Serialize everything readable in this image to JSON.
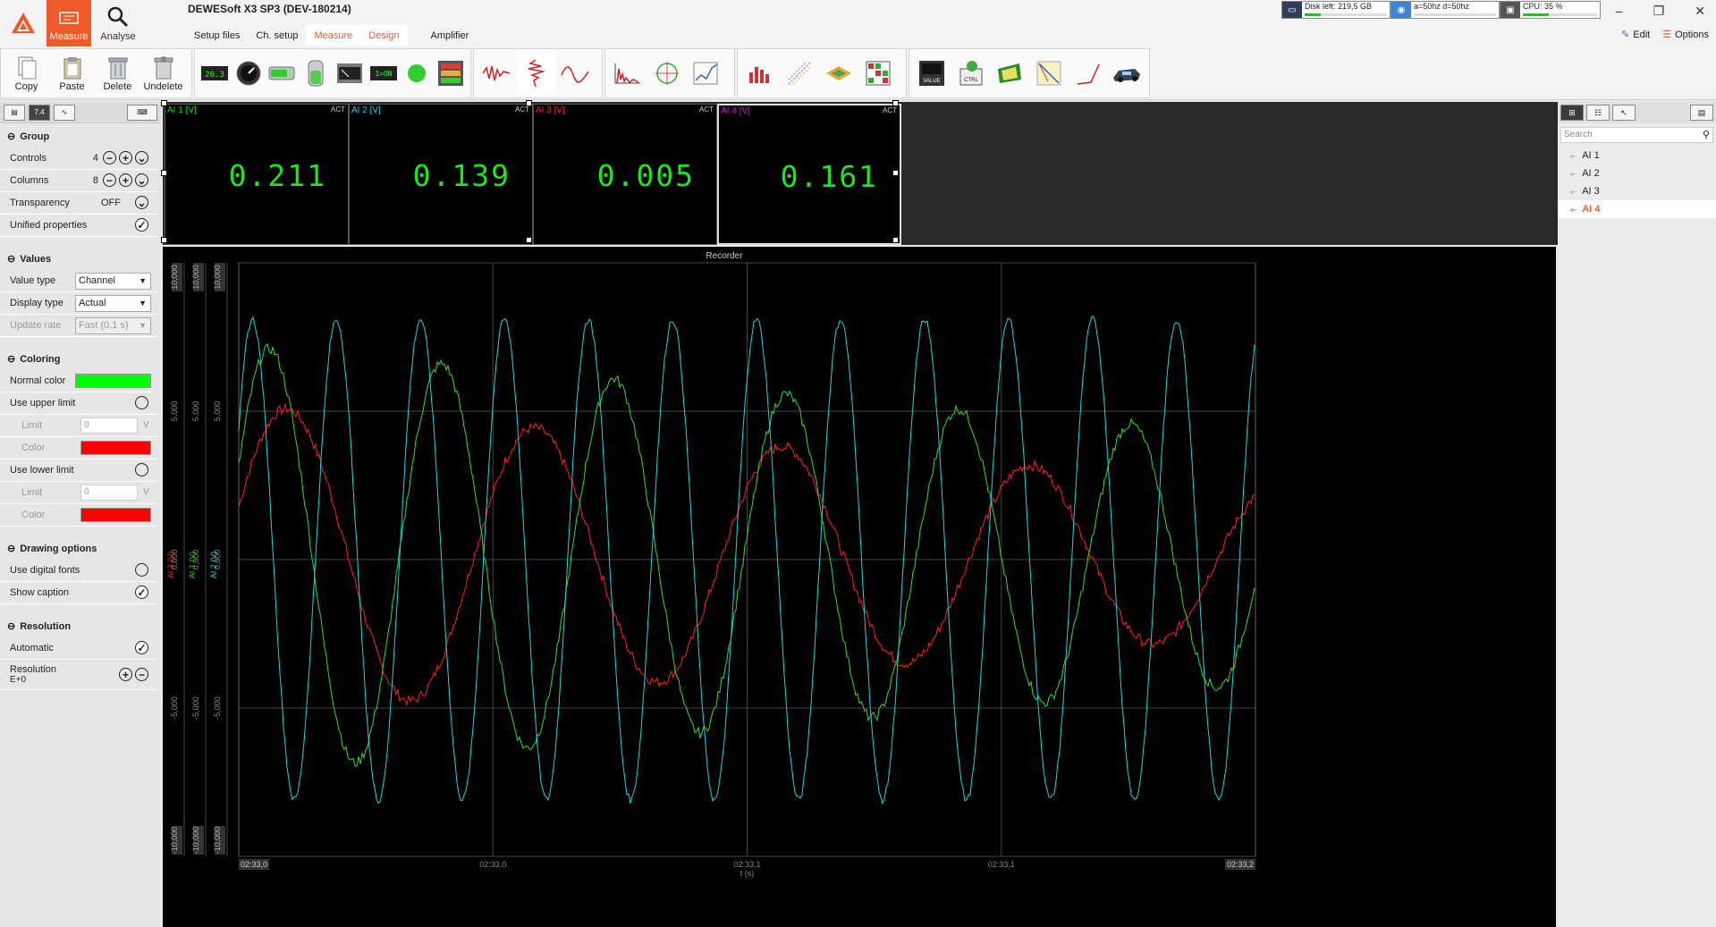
{
  "app": {
    "title": "DEWESoft X3 SP3 (DEV-180214)"
  },
  "modes": [
    {
      "label": "Measure"
    },
    {
      "label": "Analyse"
    }
  ],
  "tabs": [
    {
      "label": "Setup files"
    },
    {
      "label": "Ch. setup"
    },
    {
      "label": "Measure"
    },
    {
      "label": "Design"
    },
    {
      "label": "Amplifier"
    }
  ],
  "status": {
    "disk": {
      "text": "Disk left: 219,5 GB",
      "fill": 0.2
    },
    "sync": {
      "text": "a=50hz d=50hz"
    },
    "cpu": {
      "text": "CPU: 35 %",
      "fill": 0.35
    }
  },
  "header_actions": {
    "edit": "Edit",
    "options": "Options"
  },
  "toolbar": {
    "copy": "Copy",
    "paste": "Paste",
    "delete": "Delete",
    "undelete": "Undelete"
  },
  "panel": {
    "sections": {
      "group": "Group",
      "values": "Values",
      "coloring": "Coloring",
      "drawing": "Drawing options",
      "resolution": "Resolution"
    },
    "group": {
      "controls_label": "Controls",
      "controls_value": "4",
      "columns_label": "Columns",
      "columns_value": "8",
      "transparency_label": "Transparency",
      "transparency_value": "OFF",
      "unified_label": "Unified properties"
    },
    "values": {
      "value_type_label": "Value type",
      "value_type": "Channel",
      "display_type_label": "Display type",
      "display_type": "Actual",
      "update_rate_label": "Update rate",
      "update_rate": "Fast (0,1 s)"
    },
    "coloring": {
      "normal_color_label": "Normal color",
      "normal_color": "#00ff00",
      "upper_label": "Use upper limit",
      "limit_label": "Limit",
      "upper_limit": "0",
      "unit": "V",
      "color_label": "Color",
      "upper_color": "#ff0000",
      "lower_label": "Use lower limit",
      "lower_limit": "0",
      "lower_color": "#ff0000"
    },
    "drawing": {
      "digital_fonts": "Use digital fonts",
      "show_caption": "Show caption"
    },
    "resolution": {
      "automatic": "Automatic",
      "resolution_label": "Resolution",
      "resolution_value": "E+0"
    }
  },
  "meters": [
    {
      "caption": "AI 1 [V]",
      "value": "0.211",
      "color": "#00e000",
      "act": "ACT"
    },
    {
      "caption": "AI 2 [V]",
      "value": "0.139",
      "color": "#19d6e6",
      "act": "ACT"
    },
    {
      "caption": "AI 3 [V]",
      "value": "0.005",
      "color": "#ff2020",
      "act": "ACT"
    },
    {
      "caption": "AI 4 [V]",
      "value": "0.161",
      "color": "#e600e6",
      "act": "ACT"
    }
  ],
  "recorder": {
    "title": "Recorder",
    "xlabel": "t (s)",
    "x_ticks": [
      "02:33,0",
      "02:33,0",
      "02:33,1",
      "02:33,1",
      "02:33,2"
    ],
    "axes": [
      {
        "name": "AI 3 (V)",
        "color": "#ff2020",
        "ticks": [
          "10,000",
          "5,000",
          "0,000",
          "-5,000",
          "-10,000"
        ]
      },
      {
        "name": "AI 1 (V)",
        "color": "#00e000",
        "ticks": [
          "10,000",
          "5,000",
          "0,000",
          "-5,000",
          "-10,000"
        ]
      },
      {
        "name": "AI 2 (V)",
        "color": "#19d6e6",
        "ticks": [
          "10,000",
          "5,000",
          "0,000",
          "-5,000",
          "-10,000"
        ]
      }
    ],
    "series_colors": {
      "AI 1": "#33dd33",
      "AI 2": "#22d3e0",
      "AI 3": "#ff2020"
    }
  },
  "channels": {
    "search_placeholder": "Search",
    "items": [
      "AI 1",
      "AI 2",
      "AI 3",
      "AI 4"
    ],
    "selected": "AI 4"
  }
}
